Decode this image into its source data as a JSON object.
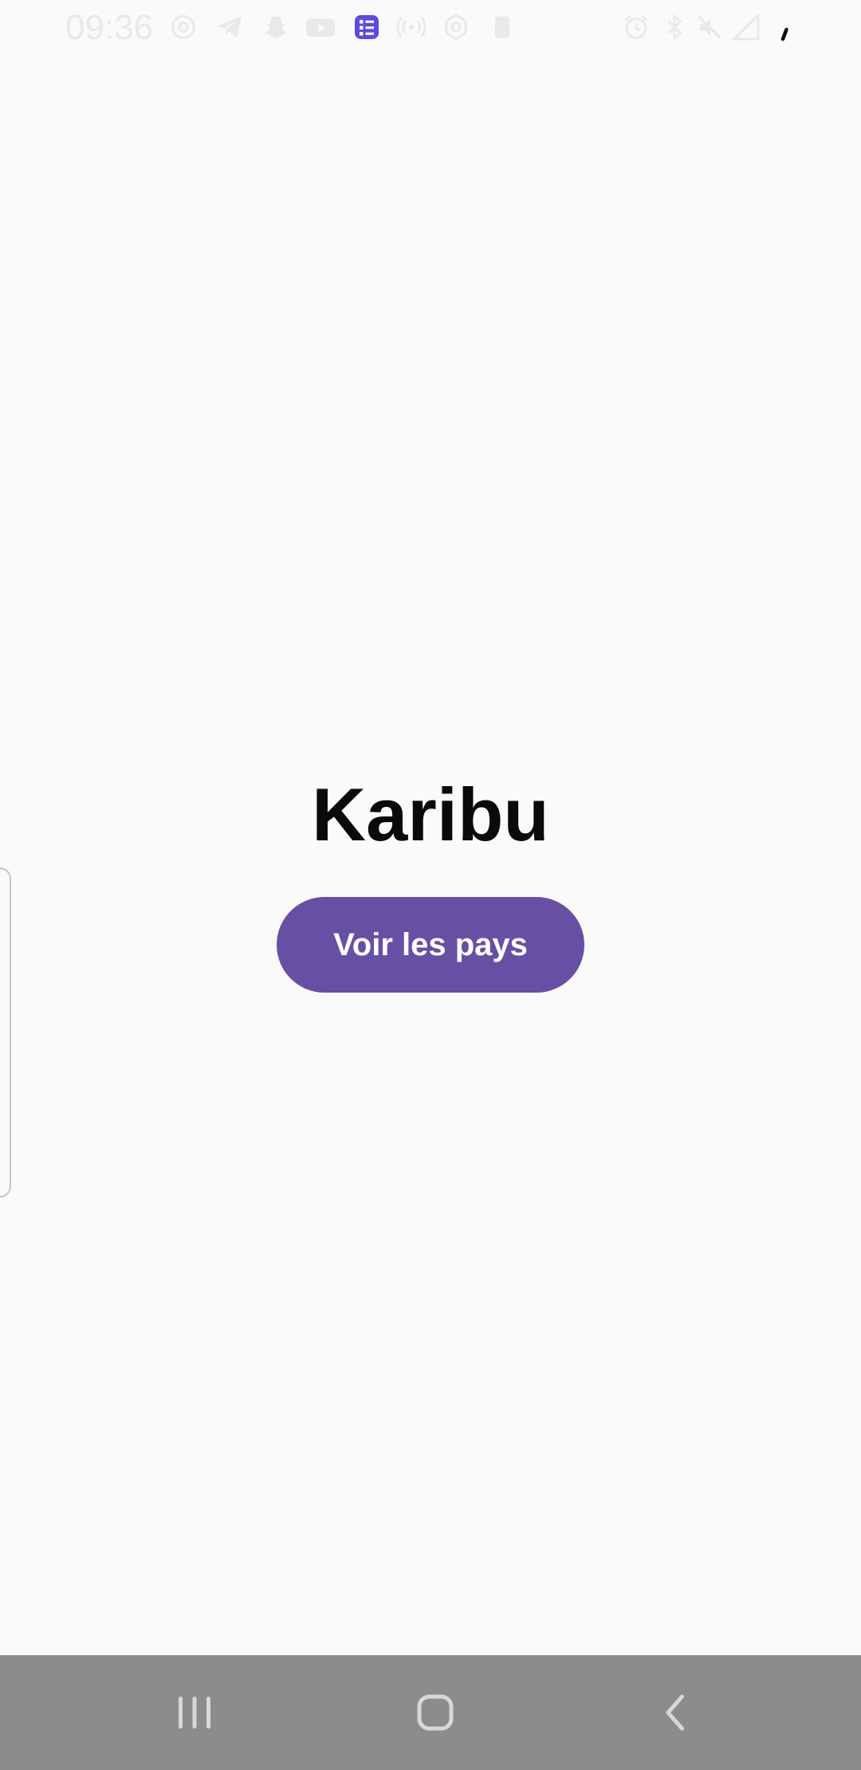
{
  "status_bar": {
    "time": "09:36",
    "icons": [
      "at-sign-icon",
      "telegram-icon",
      "snapchat-icon",
      "youtube-icon",
      "task-list-icon",
      "hotspot-icon",
      "settings-gear-icon",
      "clipboard-icon",
      "alarm-icon",
      "bluetooth-icon",
      "mute-icon",
      "signal-icon",
      "battery-icon"
    ]
  },
  "main": {
    "title": "Karibu",
    "button_label": "Voir les pays"
  },
  "colors": {
    "accent": "#6750a4",
    "background": "#fafafa",
    "nav_bar": "#8c8c8c"
  },
  "nav_bar": {
    "buttons": [
      "recent-apps-icon",
      "home-icon",
      "back-icon"
    ]
  }
}
